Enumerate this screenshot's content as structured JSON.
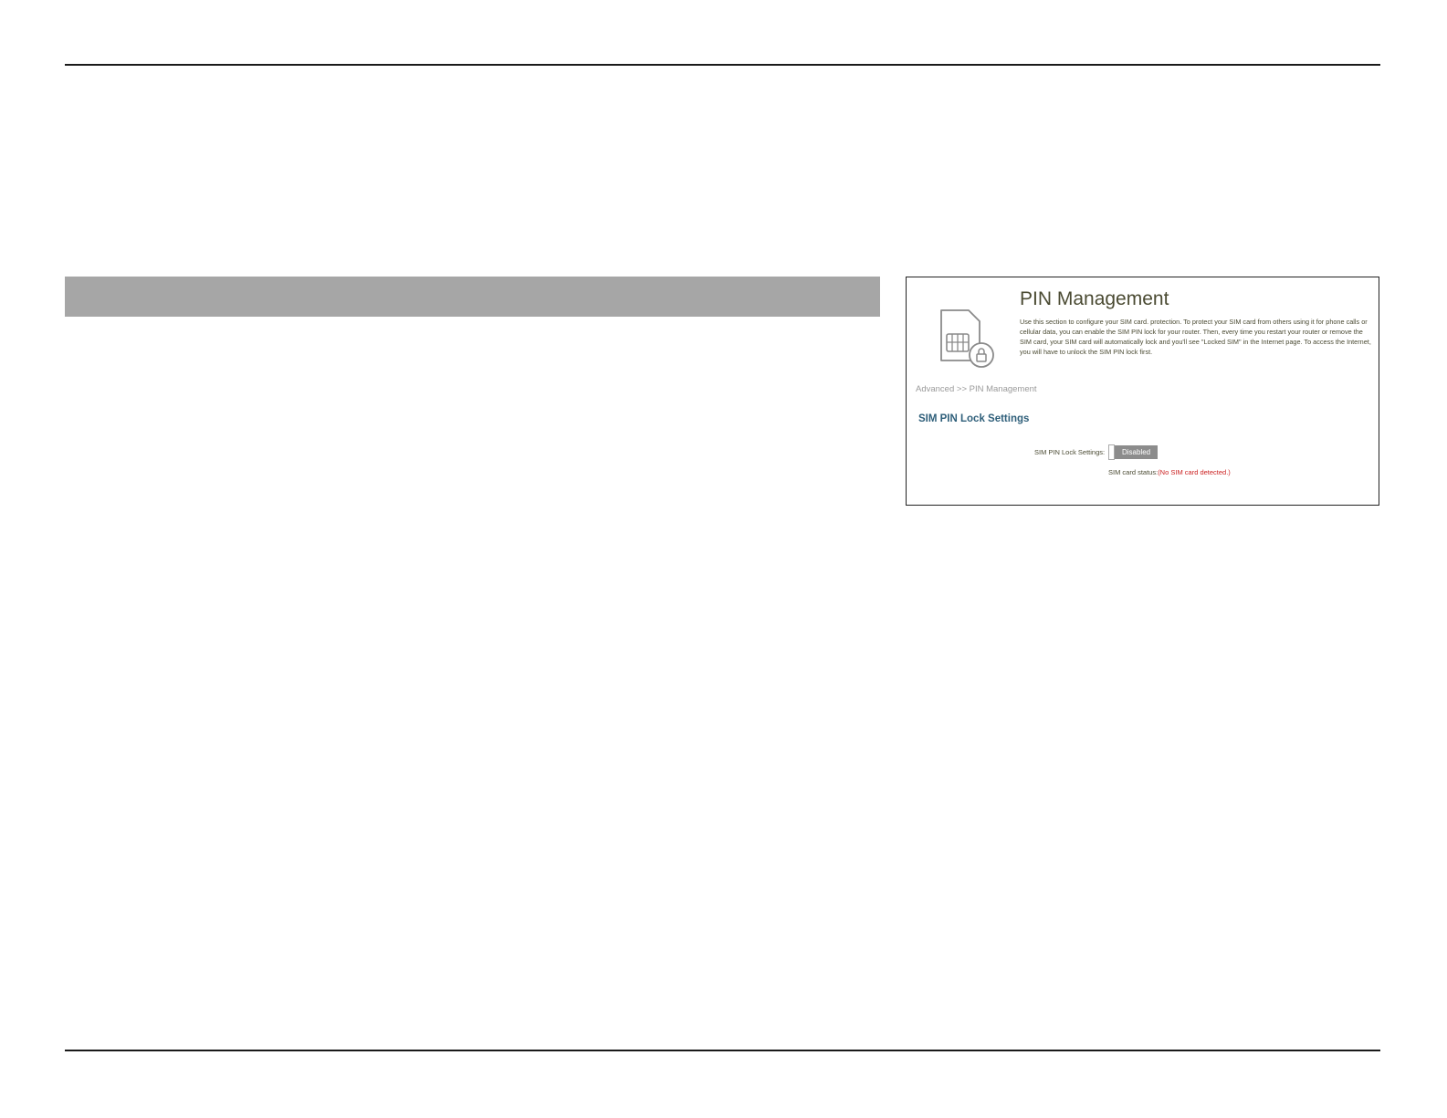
{
  "pin_management": {
    "title": "PIN Management",
    "description": "Use this section to configure your SIM card. protection. To protect your SIM card from others using it for phone calls or cellular data, you can enable the SIM PIN lock for your router. Then, every time you restart your router or remove the SIM card, your SIM card will automatically lock and you'll see \"Locked SIM\" in the Internet page. To access the Internet, you will have to unlock the SIM PIN lock first.",
    "breadcrumb": "Advanced >> PIN Management",
    "section_title": "SIM PIN Lock Settings",
    "setting_label": "SIM PIN Lock Settings:",
    "toggle_state": "Disabled",
    "sim_status_label": "SIM card status:",
    "sim_status_value": "(No SIM card detected.)",
    "icon": "sim-card-lock-icon"
  },
  "colors": {
    "section_bar": "#a6a6a6",
    "title_text": "#4a4a32",
    "section_heading": "#2f5f7a",
    "toggle_bg": "#8c8c8c",
    "status_error": "#cc2222"
  }
}
